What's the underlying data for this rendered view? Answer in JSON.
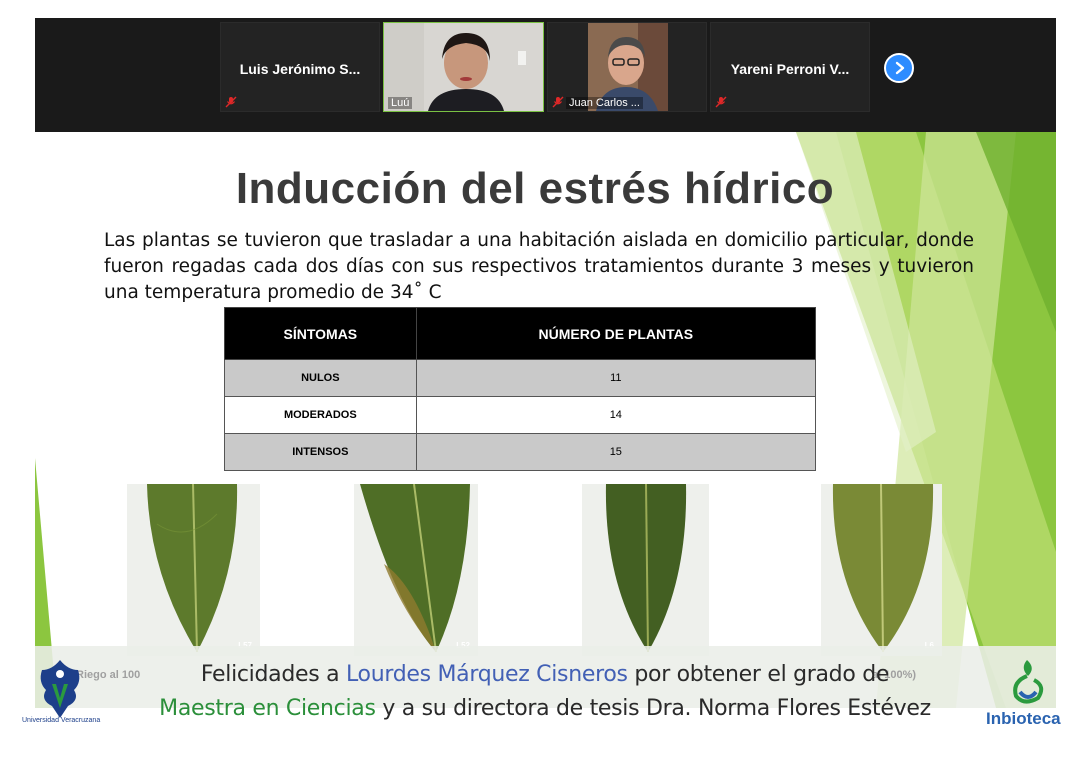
{
  "gallery": {
    "participants": [
      {
        "name": "Luis Jerónimo S...",
        "video": false,
        "muted": true
      },
      {
        "name": "Luú",
        "video": true,
        "muted": false,
        "active_speaker": true
      },
      {
        "name": "Juan Carlos ...",
        "video": true,
        "muted": true
      },
      {
        "name": "Yareni Perroni V...",
        "video": false,
        "muted": true
      }
    ],
    "next_icon": "chevron-right-icon"
  },
  "slide": {
    "title": "Inducción del estrés hídrico",
    "body": "Las plantas se tuvieron que trasladar a una habitación aislada en domicilio particular, donde fueron regadas cada dos días con sus respectivos tratamientos durante 3 meses y tuvieron una temperatura promedio de 34˚ C",
    "table": {
      "headers": [
        "SÍNTOMAS",
        "NÚMERO DE PLANTAS"
      ],
      "rows": [
        {
          "symptom": "NULOS",
          "count": "11"
        },
        {
          "symptom": "MODERADOS",
          "count": "14"
        },
        {
          "symptom": "INTENSOS",
          "count": "15"
        }
      ]
    },
    "leaf_photos": [
      {
        "tag": "L57"
      },
      {
        "tag": "L52"
      },
      {
        "tag": ""
      },
      {
        "tag": "L6"
      }
    ],
    "captions_faded": {
      "left": "Riego al 100",
      "right": "al 100%)"
    }
  },
  "banner": {
    "line1": {
      "pre": "Felicidades a ",
      "name": "Lourdes Márquez Cisneros",
      "post": " por obtener el grado de"
    },
    "line2": {
      "degree": "Maestra en Ciencias",
      "mid": " y a su directora de tesis ",
      "director": "Dra. Norma Flores Estévez"
    },
    "left_logo_text": "Universidad Veracruzana",
    "right_logo_text": "Inbioteca"
  },
  "colors": {
    "zoom_blue": "#2d8cff",
    "active_border": "#7ac143",
    "brand_green": "#2b8f3a",
    "brand_blue": "#4260b5"
  }
}
